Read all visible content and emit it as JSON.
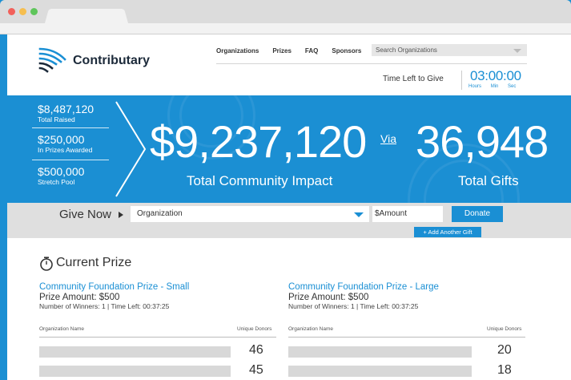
{
  "header": {
    "brand": "Contributary",
    "nav": [
      "Organizations",
      "Prizes",
      "FAQ",
      "Sponsors"
    ],
    "search_placeholder": "Search Organizations",
    "time_left_label": "Time Left to Give",
    "timer": "03:00:00",
    "timer_units": [
      "Hours",
      "Min",
      "Sec"
    ]
  },
  "banner": {
    "stats": [
      {
        "value": "$8,487,120",
        "label": "Total Raised"
      },
      {
        "value": "$250,000",
        "label": "In Prizes Awarded"
      },
      {
        "value": "$500,000",
        "label": "Stretch Pool"
      }
    ],
    "impact_value": "$9,237,120",
    "impact_label": "Total Community Impact",
    "via": "Via",
    "gifts_value": "36,948",
    "gifts_label": "Total Gifts"
  },
  "give": {
    "label": "Give Now",
    "org_placeholder": "Organization",
    "amount_placeholder": "$Amount",
    "donate_label": "Donate",
    "add_gift_label": "+ Add Another Gift"
  },
  "prizes": {
    "section_title": "Current Prize",
    "columns": [
      {
        "title": "Community Foundation Prize - Small",
        "amount": "Prize Amount: $500",
        "meta": "Number of Winners: 1  |  Time Left: 00:37:25",
        "col_org": "Organization Name",
        "col_donors": "Unique Donors",
        "rows": [
          {
            "donors": "46",
            "fill": 0.92
          },
          {
            "donors": "45",
            "fill": 0.92
          }
        ]
      },
      {
        "title": "Community Foundation Prize - Large",
        "amount": "Prize Amount: $500",
        "meta": "Number of Winners: 1  |  Time Left: 00:37:25",
        "col_org": "Organization Name",
        "col_donors": "Unique Donors",
        "rows": [
          {
            "donors": "20",
            "fill": 0.88
          },
          {
            "donors": "18",
            "fill": 0.88
          }
        ]
      }
    ]
  }
}
